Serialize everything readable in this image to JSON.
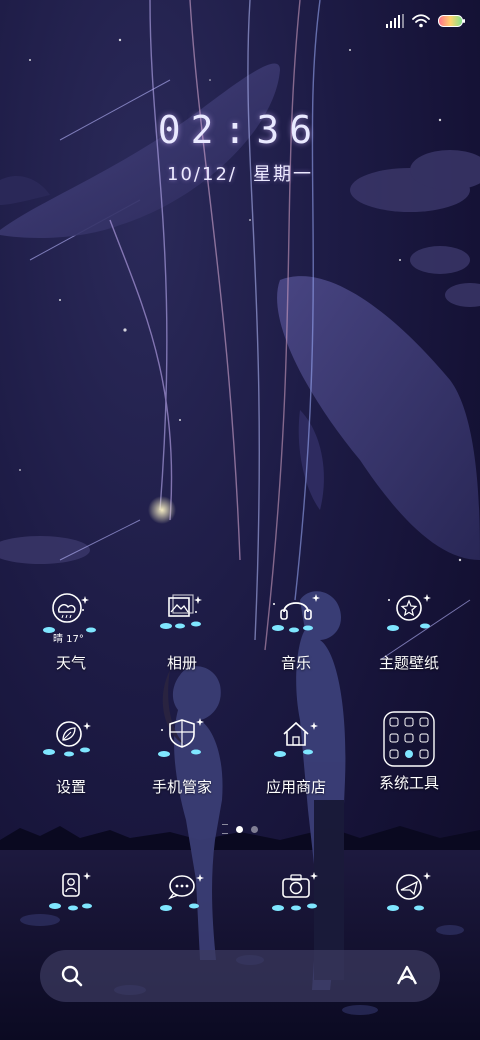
{
  "status_bar": {
    "signal_icon": "signal-bars-icon",
    "wifi_icon": "wifi-icon",
    "battery_icon": "battery-icon"
  },
  "lockclock": {
    "time": "02:36",
    "date_part": "10/12/",
    "weekday": "星期一"
  },
  "apps": [
    {
      "label": "天气",
      "icon": "weather-cloud-icon",
      "weather_text": "晴 17°"
    },
    {
      "label": "相册",
      "icon": "gallery-icon"
    },
    {
      "label": "音乐",
      "icon": "headphones-icon"
    },
    {
      "label": "主题壁纸",
      "icon": "theme-star-icon"
    },
    {
      "label": "设置",
      "icon": "settings-leaf-icon"
    },
    {
      "label": "手机管家",
      "icon": "shield-icon"
    },
    {
      "label": "应用商店",
      "icon": "home-store-icon"
    },
    {
      "label": "系统工具",
      "icon": "tools-folder-icon"
    }
  ],
  "dock_apps": [
    {
      "icon": "contacts-icon"
    },
    {
      "icon": "messages-icon"
    },
    {
      "icon": "camera-icon"
    },
    {
      "icon": "browser-plane-icon"
    }
  ],
  "page_indicator": {
    "pages": 2,
    "active": 1
  },
  "search_bar": {
    "search_icon": "search-icon",
    "assistant_icon": "assistant-a-icon"
  },
  "colors": {
    "accent_fish": "#7fe6ff",
    "icon_line": "#ffffff",
    "sky_top": "#2b2a5a",
    "sky_bottom": "#0f0c28"
  }
}
